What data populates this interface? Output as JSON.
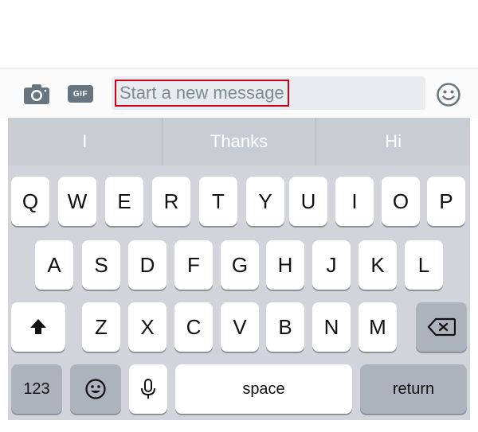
{
  "composer": {
    "placeholder": "Start a new message",
    "gif_label": "GIF",
    "icons": [
      "camera-icon",
      "gif-icon",
      "smiley-icon"
    ],
    "highlight_color": "#d0021b"
  },
  "suggestions": [
    "I",
    "Thanks",
    "Hi"
  ],
  "keyboard": {
    "row1": [
      "Q",
      "W",
      "E",
      "R",
      "T",
      "Y",
      "U",
      "I",
      "O",
      "P"
    ],
    "row2": [
      "A",
      "S",
      "D",
      "F",
      "G",
      "H",
      "J",
      "K",
      "L"
    ],
    "row3": [
      "Z",
      "X",
      "C",
      "V",
      "B",
      "N",
      "M"
    ],
    "numbers_label": "123",
    "space_label": "space",
    "return_label": "return",
    "icons": [
      "shift-icon",
      "backspace-icon",
      "emoji-keyboard-icon",
      "microphone-icon"
    ]
  }
}
